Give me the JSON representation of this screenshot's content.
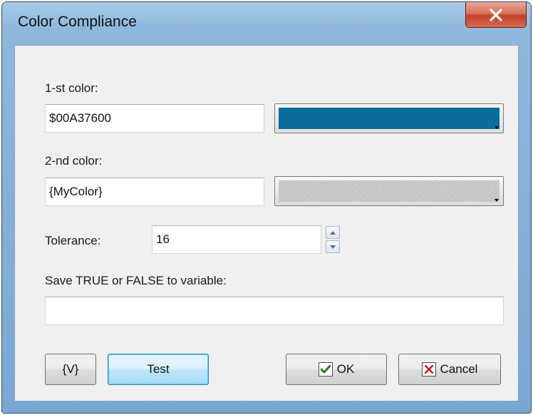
{
  "window": {
    "title": "Color Compliance",
    "close_glyph": "x"
  },
  "first_color": {
    "label": "1-st color:",
    "value": "$00A37600",
    "swatch_color": "#0a6e9c",
    "picker_icon": "dropdown-arrow-icon"
  },
  "second_color": {
    "label": "2-nd color:",
    "value": "{MyColor}",
    "swatch_pattern": "checker",
    "picker_icon": "dropdown-arrow-icon"
  },
  "tolerance": {
    "label": "Tolerance:",
    "value": "16"
  },
  "save_variable": {
    "label": "Save TRUE or FALSE to variable:",
    "value": ""
  },
  "buttons": {
    "variables": "{V}",
    "test": "Test",
    "ok": "OK",
    "cancel": "Cancel"
  },
  "colors": {
    "ok_check": "#1f7a1f",
    "cancel_x": "#d11a1a",
    "close_button": "#c2432b"
  }
}
